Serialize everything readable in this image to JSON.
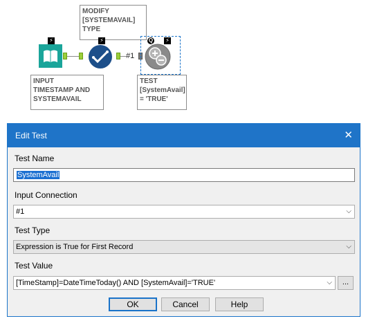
{
  "canvas": {
    "annotations": {
      "modify": "MODIFY\n[SYSTEMAVAIL]\nTYPE",
      "input": "INPUT\nTIMESTAMP AND\nSYSTEMAVAIL",
      "test": "TEST\n[SystemAvail]\n= 'TRUE'"
    },
    "connection_label": "#1",
    "test_tool_badge": "Q"
  },
  "dialog": {
    "title": "Edit Test",
    "test_name_label": "Test Name",
    "test_name_value": "SystemAvail",
    "input_connection_label": "Input Connection",
    "input_connection_value": "#1",
    "test_type_label": "Test Type",
    "test_type_value": "Expression is True for First Record",
    "test_value_label": "Test Value",
    "test_value_value": "[TimeStamp]=DateTimeToday() AND [SystemAvail]='TRUE'",
    "ellipsis_label": "...",
    "ok_label": "OK",
    "cancel_label": "Cancel",
    "help_label": "Help"
  },
  "colors": {
    "titlebar": "#1f74c8",
    "input_tool": "#1aa59a",
    "formula_tool": "#1d4f8a",
    "test_tool": "#8a8a8a",
    "anchor": "#9ccf3a"
  }
}
